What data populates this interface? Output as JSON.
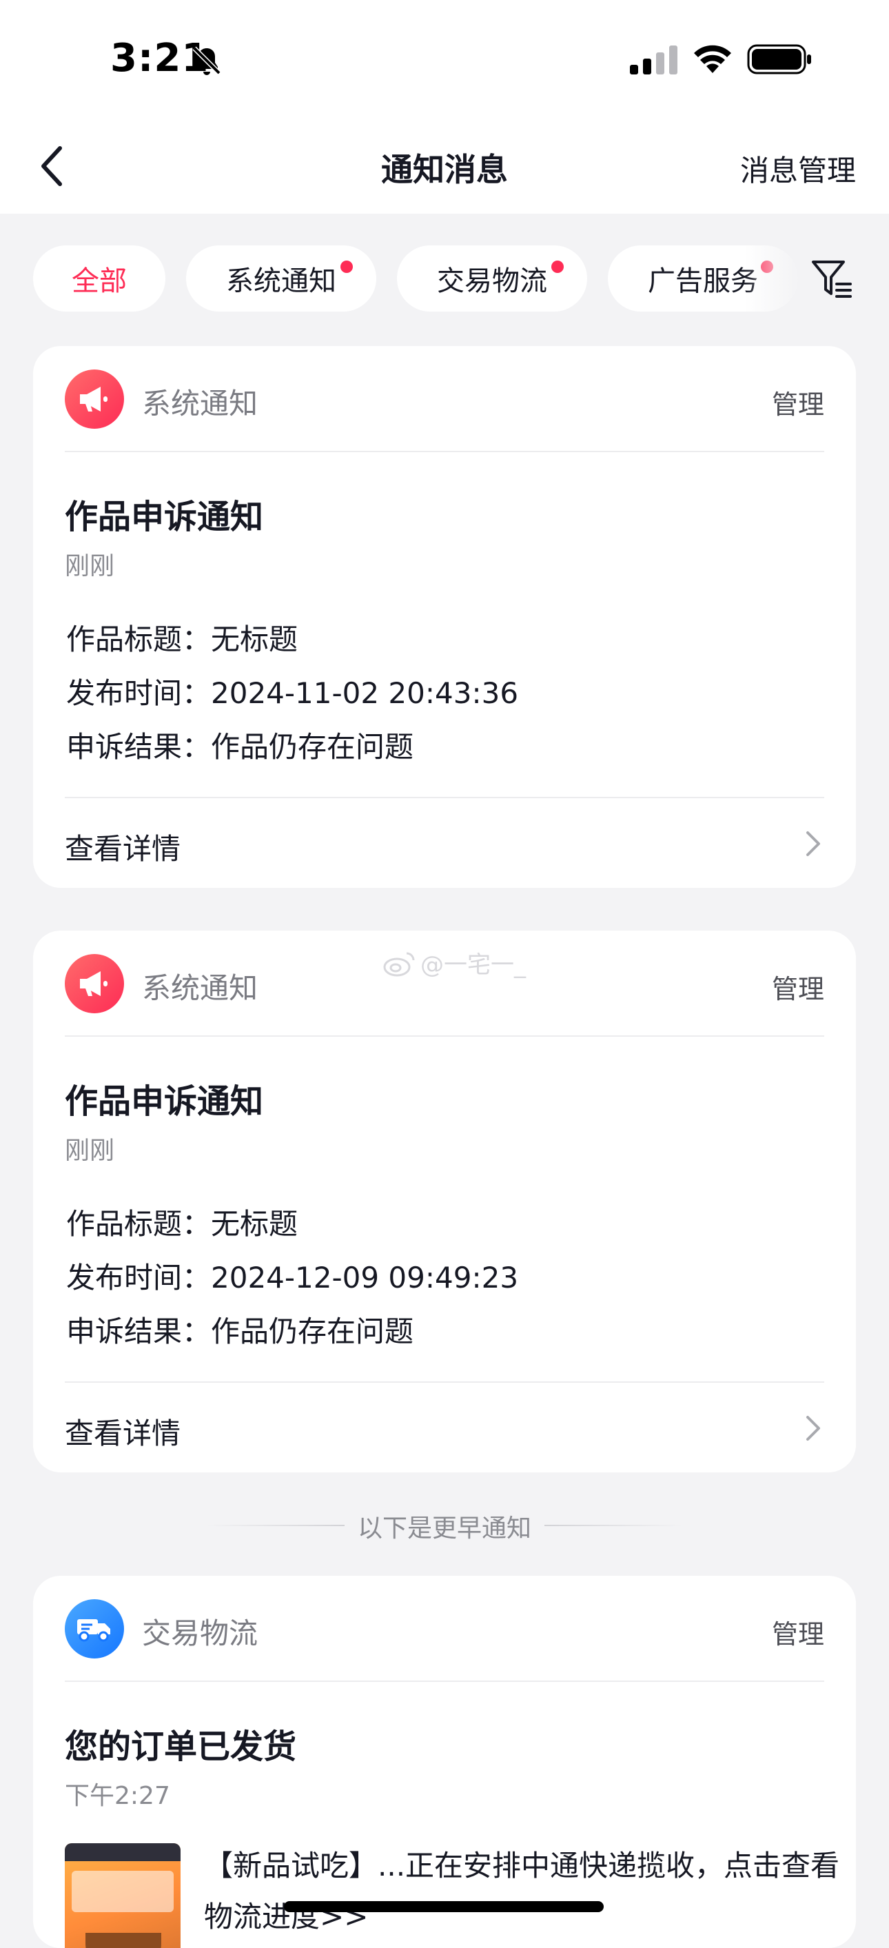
{
  "status_bar": {
    "time": "3:21"
  },
  "nav": {
    "title": "通知消息",
    "manage_label": "消息管理"
  },
  "filters": {
    "tabs": [
      {
        "label": "全部",
        "active": true,
        "has_dot": false
      },
      {
        "label": "系统通知",
        "active": false,
        "has_dot": true
      },
      {
        "label": "交易物流",
        "active": false,
        "has_dot": true
      },
      {
        "label": "广告服务",
        "active": false,
        "has_dot": true
      }
    ]
  },
  "cards": [
    {
      "source": "系统通知",
      "manage_label": "管理",
      "title": "作品申诉通知",
      "time": "刚刚",
      "lines": [
        "作品标题：无标题",
        "发布时间：2024-11-02 20:43:36",
        "申诉结果：作品仍存在问题"
      ],
      "detail_label": "查看详情"
    },
    {
      "source": "系统通知",
      "manage_label": "管理",
      "title": "作品申诉通知",
      "time": "刚刚",
      "lines": [
        "作品标题：无标题",
        "发布时间：2024-12-09 09:49:23",
        "申诉结果：作品仍存在问题"
      ],
      "detail_label": "查看详情"
    },
    {
      "source": "交易物流",
      "manage_label": "管理",
      "title": "您的订单已发货",
      "time": "下午2:27",
      "description": "【新品试吃】...正在安排中通快递揽收，点击查看物流进度>>"
    }
  ],
  "earlier_label": "以下是更早通知",
  "watermark": "@一宅一_",
  "colors": {
    "accent": "#fe2c55",
    "background": "#f3f3f5",
    "card": "#ffffff",
    "logistics_blue": "#1677ff"
  },
  "icons": [
    "bell-muted-icon",
    "signal-icon",
    "wifi-icon",
    "battery-icon",
    "back-arrow-icon",
    "filter-icon",
    "megaphone-icon",
    "truck-icon",
    "chevron-right-icon"
  ]
}
